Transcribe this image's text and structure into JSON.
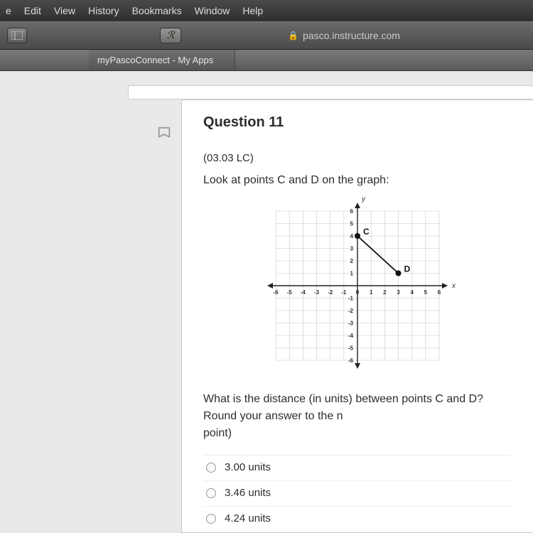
{
  "menu": {
    "items": [
      "e",
      "Edit",
      "View",
      "History",
      "Bookmarks",
      "Window",
      "Help"
    ]
  },
  "toolbar": {
    "reader_glyph": "ℛ",
    "url": "pasco.instructure.com"
  },
  "tab": {
    "title": "myPascoConnect - My Apps"
  },
  "question": {
    "title": "Question 11",
    "code": "(03.03 LC)",
    "prompt": "Look at points C and D on the graph:",
    "text2_a": "What is the distance (in units) between points C and D? Round your answer to the n",
    "text2_b": "point)",
    "answers": [
      "3.00 units",
      "3.46 units",
      "4.24 units"
    ]
  },
  "chart_data": {
    "type": "scatter",
    "title": "",
    "xlabel": "x",
    "ylabel": "y",
    "xlim": [
      -6,
      6
    ],
    "ylim": [
      -6,
      6
    ],
    "xticks": [
      -6,
      -5,
      -4,
      -3,
      -2,
      -1,
      0,
      1,
      2,
      3,
      4,
      5,
      6
    ],
    "yticks": [
      -6,
      -5,
      -4,
      -3,
      -2,
      -1,
      1,
      2,
      3,
      4,
      5,
      6
    ],
    "points": [
      {
        "name": "C",
        "x": 0,
        "y": 4
      },
      {
        "name": "D",
        "x": 3,
        "y": 1
      }
    ],
    "segments": [
      {
        "from": "C",
        "to": "D"
      }
    ]
  }
}
